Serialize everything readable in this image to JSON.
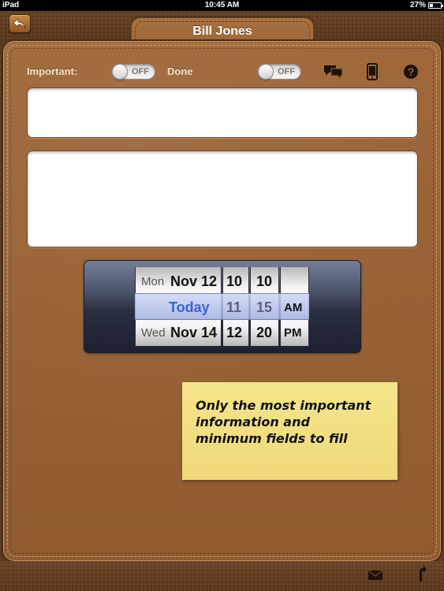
{
  "status_bar": {
    "carrier": "iPad",
    "time": "10:45 AM",
    "battery_text": "27%",
    "battery_level": 0.27
  },
  "header": {
    "title": "Bill Jones",
    "back_icon": "back-arrow-icon"
  },
  "form": {
    "important_label": "Important:",
    "important_toggle": "OFF",
    "done_label": "Done",
    "done_toggle": "OFF",
    "icons": [
      "chat-bubbles-icon",
      "phone-device-icon",
      "help-icon"
    ],
    "field_1_value": "",
    "field_2_value": ""
  },
  "date_picker": {
    "rows": [
      {
        "weekday": "Mon",
        "date": "Nov 12",
        "hour": "10",
        "minute": "10",
        "ampm": ""
      },
      {
        "weekday": "",
        "date": "Today",
        "hour": "11",
        "minute": "15",
        "ampm": "AM"
      },
      {
        "weekday": "Wed",
        "date": "Nov 14",
        "hour": "12",
        "minute": "20",
        "ampm": "PM"
      }
    ]
  },
  "note": {
    "lines": [
      "Only the most important",
      "information and",
      "minimum fields to fill"
    ]
  },
  "toolbar": {
    "icons": [
      "mail-icon",
      "share-icon"
    ]
  },
  "colors": {
    "leather": "#9a6434",
    "note": "#f2e080",
    "selected_date": "#3b63d1"
  }
}
